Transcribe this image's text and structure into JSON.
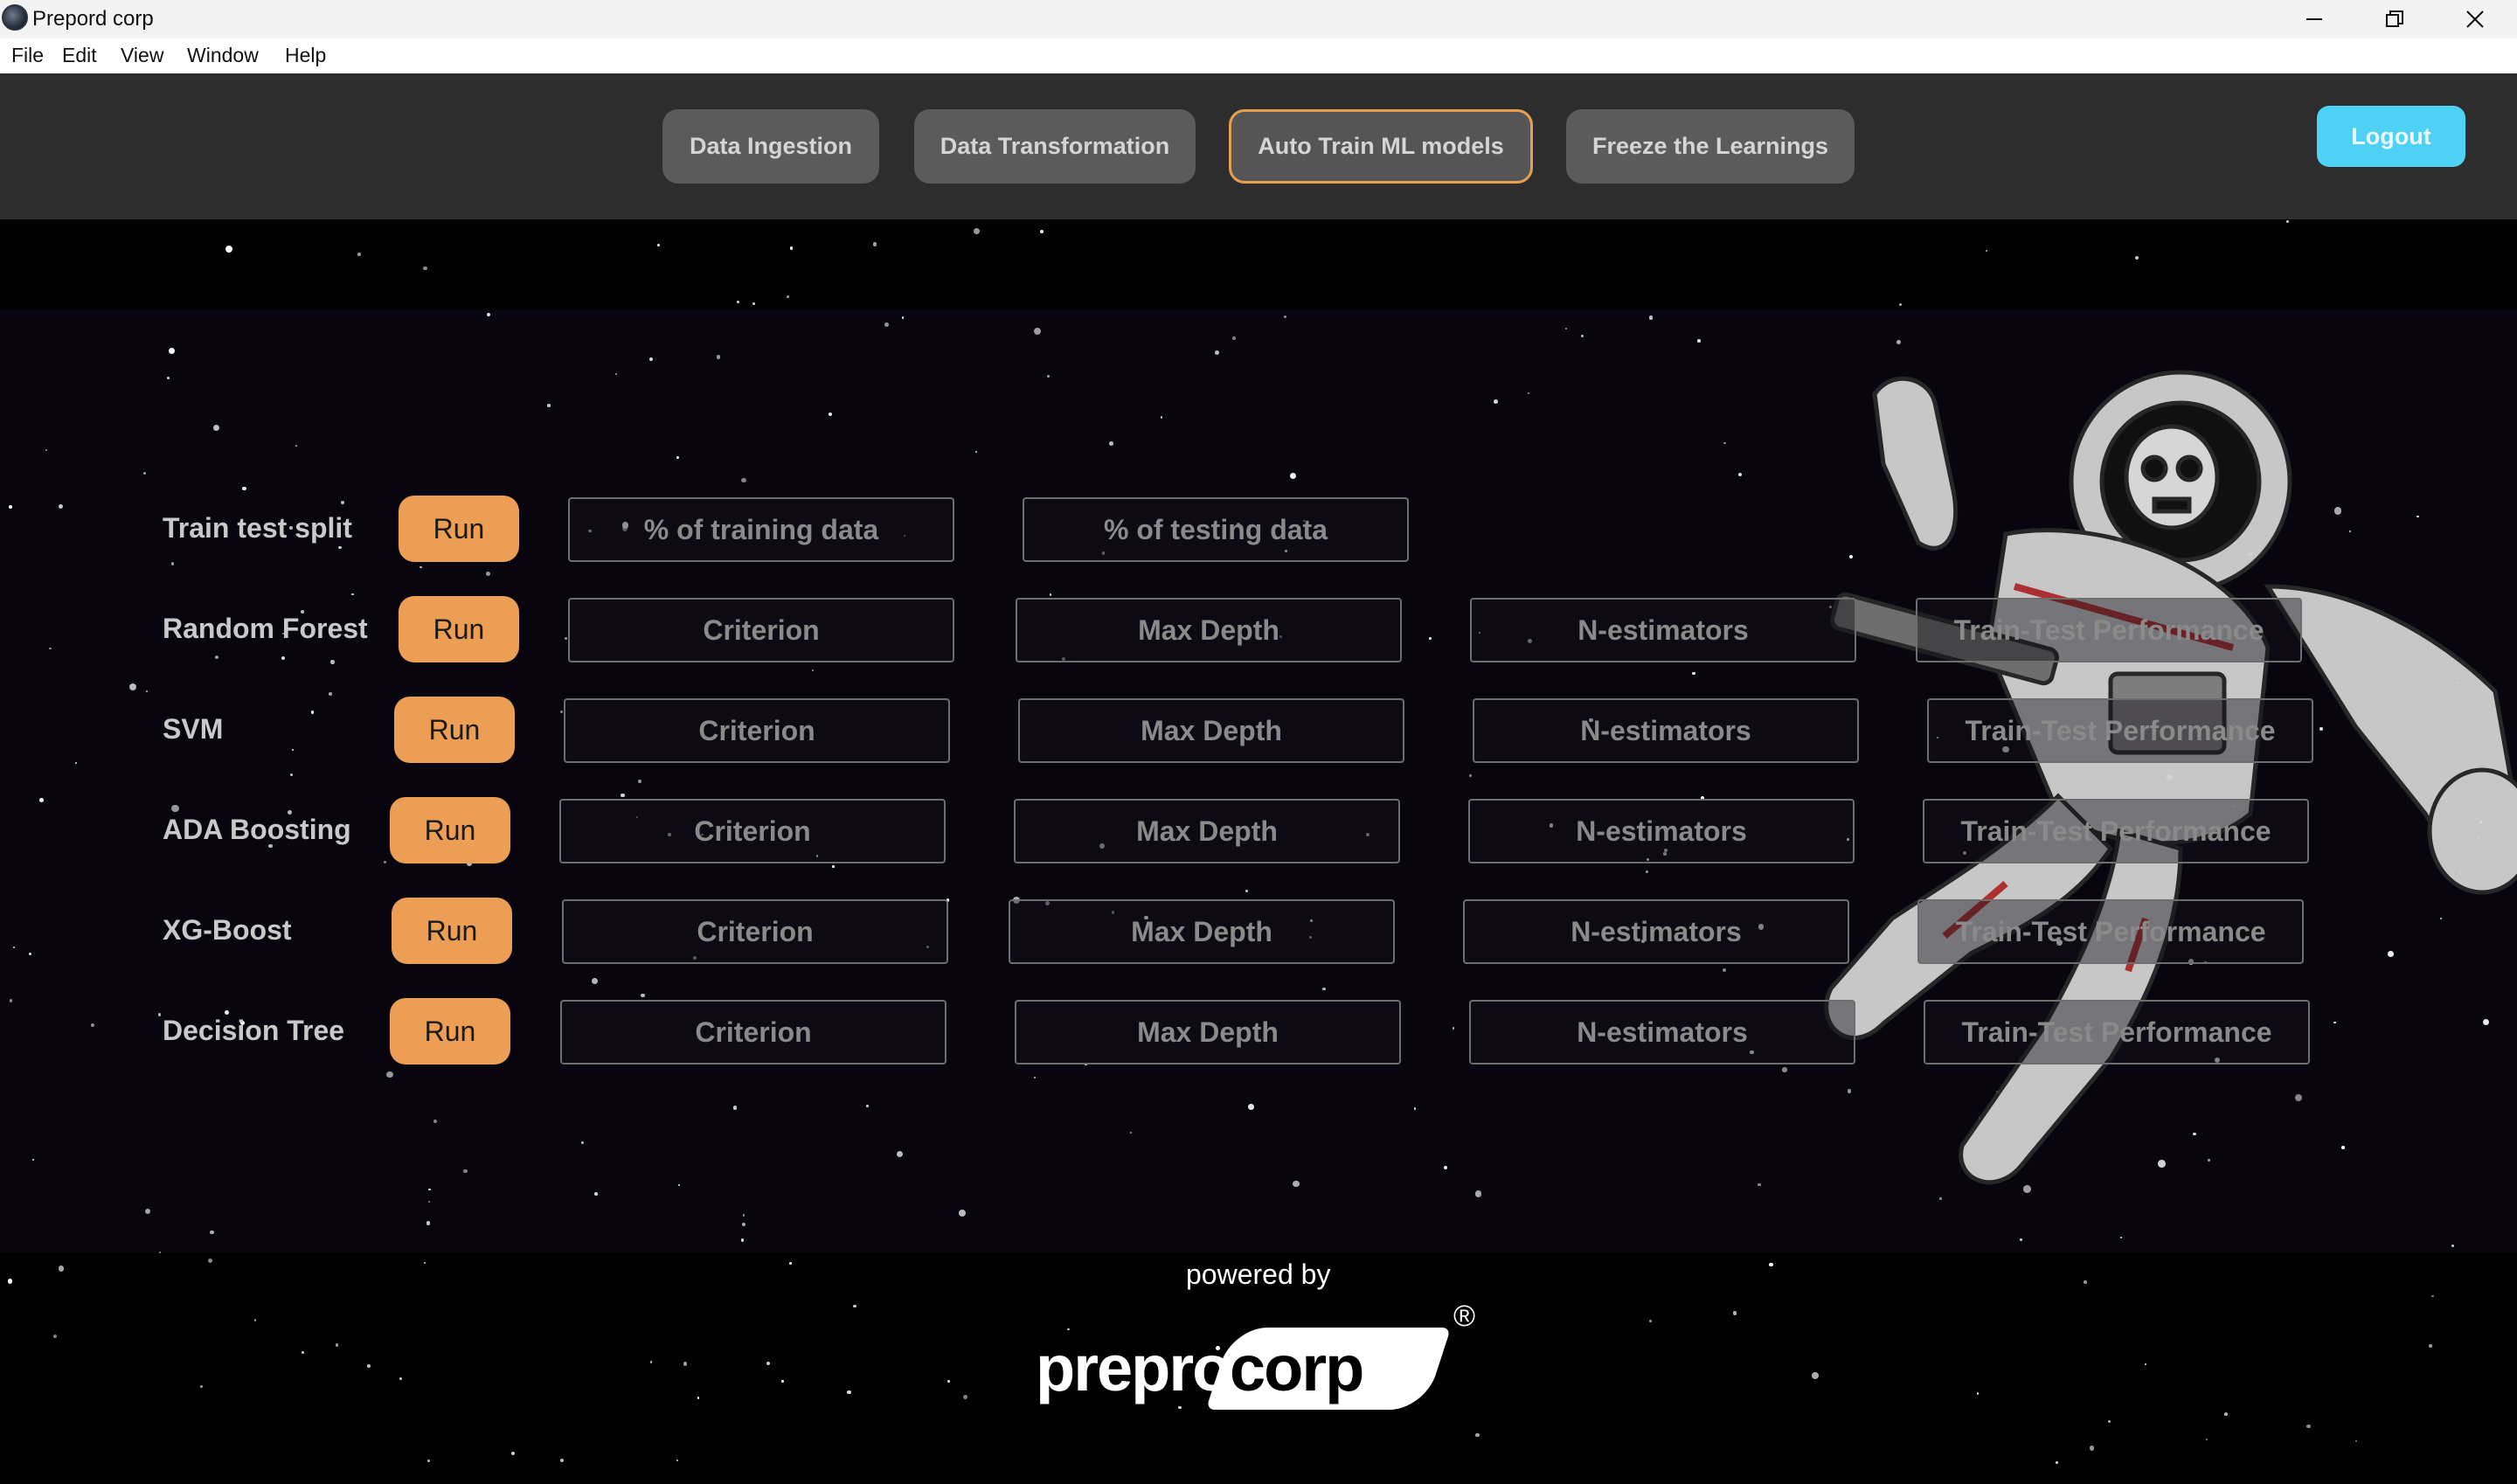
{
  "window": {
    "title": "Prepord corp"
  },
  "menu": [
    "File",
    "Edit",
    "View",
    "Window",
    "Help"
  ],
  "nav": {
    "tabs": [
      {
        "label": "Data Ingestion",
        "active": false
      },
      {
        "label": "Data Transformation",
        "active": false
      },
      {
        "label": "Auto Train ML models",
        "active": true
      },
      {
        "label": "Freeze the Learnings",
        "active": false
      }
    ],
    "logout_label": "Logout"
  },
  "rows": [
    {
      "label": "Train test split",
      "run": "Run",
      "fields": [
        "% of training data",
        "% of testing data"
      ]
    },
    {
      "label": "Random Forest",
      "run": "Run",
      "fields": [
        "Criterion",
        "Max Depth",
        "N-estimators",
        "Train-Test Performance"
      ]
    },
    {
      "label": "SVM",
      "run": "Run",
      "fields": [
        "Criterion",
        "Max Depth",
        "N-estimators",
        "Train-Test Performance"
      ]
    },
    {
      "label": "ADA Boosting",
      "run": "Run",
      "fields": [
        "Criterion",
        "Max Depth",
        "N-estimators",
        "Train-Test Performance"
      ]
    },
    {
      "label": "XG-Boost",
      "run": "Run",
      "fields": [
        "Criterion",
        "Max Depth",
        "N-estimators",
        "Train-Test Performance"
      ]
    },
    {
      "label": "Decision Tree",
      "run": "Run",
      "fields": [
        "Criterion",
        "Max Depth",
        "N-estimators",
        "Train-Test Performance"
      ]
    }
  ],
  "footer": {
    "powered_by": "powered by",
    "logo_part1": "preprod",
    "logo_part2": "corp",
    "logo_reg": "®"
  },
  "colors": {
    "accent": "#ec9f54",
    "logout": "#4fd0f5",
    "active_border": "#e6a04d"
  }
}
